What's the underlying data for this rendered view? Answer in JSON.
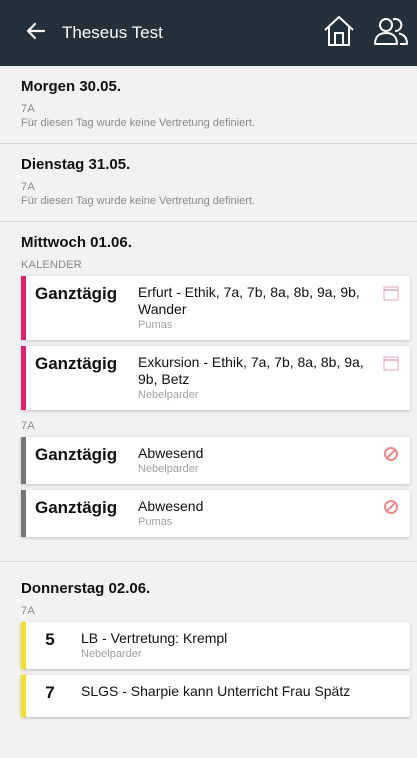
{
  "appbar": {
    "title": "Theseus Test",
    "back_icon": "back-arrow-icon",
    "home_icon": "home-icon",
    "users_icon": "users-icon",
    "background": "#24303a"
  },
  "colors": {
    "calendar_stripe": "#e0216f",
    "absence_stripe": "#777777",
    "period_stripe": "#f2df2c",
    "absent_icon": "#e88989"
  },
  "days": [
    {
      "title": "Morgen 30.05.",
      "class": "7A",
      "message": "Für diesen Tag wurde keine Vertretung definiert."
    },
    {
      "title": "Dienstag 31.05.",
      "class": "7A",
      "message": "Für diesen Tag wurde keine Vertretung definiert."
    },
    {
      "title": "Mittwoch 01.06.",
      "section_calendar": "KALENDER",
      "calendar_entries": [
        {
          "time": "Ganztägig",
          "title": "Erfurt - Ethik, 7a, 7b, 8a, 8b, 9a, 9b, Wander",
          "sub": "Pumas"
        },
        {
          "time": "Ganztägig",
          "title": "Exkursion - Ethik, 7a, 7b, 8a, 8b, 9a, 9b, Betz",
          "sub": "Nebelparder"
        }
      ],
      "section_class": "7A",
      "absence_entries": [
        {
          "time": "Ganztägig",
          "title": "Abwesend",
          "sub": "Nebelparder"
        },
        {
          "time": "Ganztägig",
          "title": "Abwesend",
          "sub": "Pumas"
        }
      ]
    },
    {
      "title": "Donnerstag 02.06.",
      "section_class": "7A",
      "period_entries": [
        {
          "period": "5",
          "title": "LB - Vertretung: Krempl",
          "sub": "Nebelparder"
        },
        {
          "period": "7",
          "title": "SLGS - Sharpie kann Unterricht Frau Spätz",
          "sub": ""
        }
      ]
    }
  ]
}
